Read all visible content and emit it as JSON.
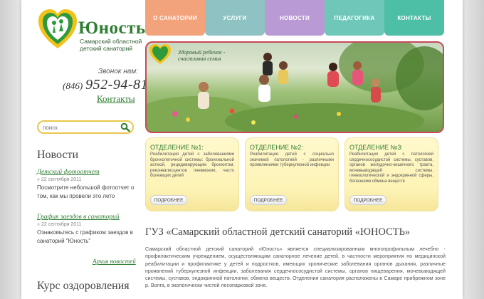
{
  "logo": {
    "name": "Юность",
    "subtitle_line1": "Самарский областной",
    "subtitle_line2": "детский санаторий"
  },
  "phone": {
    "label": "Звонок нам:",
    "code": "(846)",
    "number": "952-94-81"
  },
  "contacts_link": "Контакты",
  "search": {
    "placeholder": "поиск",
    "value": ""
  },
  "news": {
    "heading": "Новости",
    "items": [
      {
        "title": "Детский фотоотчет",
        "date": "22 сентября 2011",
        "text": "Посмотрите небольшой фотоотчет о том, как мы провели это лето"
      },
      {
        "title": "График заездов в санаторий",
        "date": "22 сентября 2011",
        "text": "Ознакомьтесь с графиком заездов в санаторий \"Юность\""
      }
    ],
    "archive": "Архив новостей"
  },
  "course_heading": "Курс оздоровления",
  "nav": [
    {
      "label": "О САНАТОРИИ",
      "color": "#f3a37c"
    },
    {
      "label": "УСЛУГИ",
      "color": "#8fc3c3"
    },
    {
      "label": "НОВОСТИ",
      "color": "#b99ad4"
    },
    {
      "label": "ПЕДАГОГИКА",
      "color": "#6fc7ba"
    },
    {
      "label": "КОНТАКТЫ",
      "color": "#4dbfa6"
    }
  ],
  "banner": {
    "slogan_line1": "Здоровый ребенок -",
    "slogan_line2": "счастливая семья",
    "border_color": "#c84a5a"
  },
  "departments": [
    {
      "title": "ОТДЕЛЕНИЕ №1:",
      "text": "Реабилитация детей с заболеваниями бронхолегочной системы: бронхиальной астмой, рецидивирующим бронхитом, реконвалесцентов пневмонии, часто болеющих детей",
      "button": "ПОДРОБНЕЕ"
    },
    {
      "title": "ОТДЕЛЕНИЕ №2:",
      "text": "Реабилитация детей с социально значимой патологией - различными проявлениями туберкулезной инфекции",
      "button": "ПОДРОБНЕЕ"
    },
    {
      "title": "ОТДЕЛЕНИЕ №3:",
      "text": "Реабилитация детей с патологией сердечнососудистой системы, суставов, органов желудочно-кишечного тракта, мочевыводящей системы, гинекологической и эндокринной сферы, болезнями обмена веществ",
      "button": "ПОДРОБНЕЕ"
    }
  ],
  "main": {
    "heading": "ГУЗ «Самарский областной детский санаторий «ЮНОСТЬ»",
    "paragraph": "Самарский областной детский санаторий «Юность» является специализированным многопрофильным лечебно - профилактическим учреждением, осуществляющим санаторное лечение детей, в частности мероприятия по медицинской реабилитации и профилактике у детей и подростков, имеющих хронические заболевания органов дыхания, различные проявлений туберкулезной инфекции, заболевания сердечнососудистой системы, органов пищеварения, мочевыводящей системы, суставов, эндокринной патологии, обмена веществ. Отделения санатория расположены в Самаре прибрежном зоне р. Волга, в экологически чистой лесопарковой зоне."
  }
}
